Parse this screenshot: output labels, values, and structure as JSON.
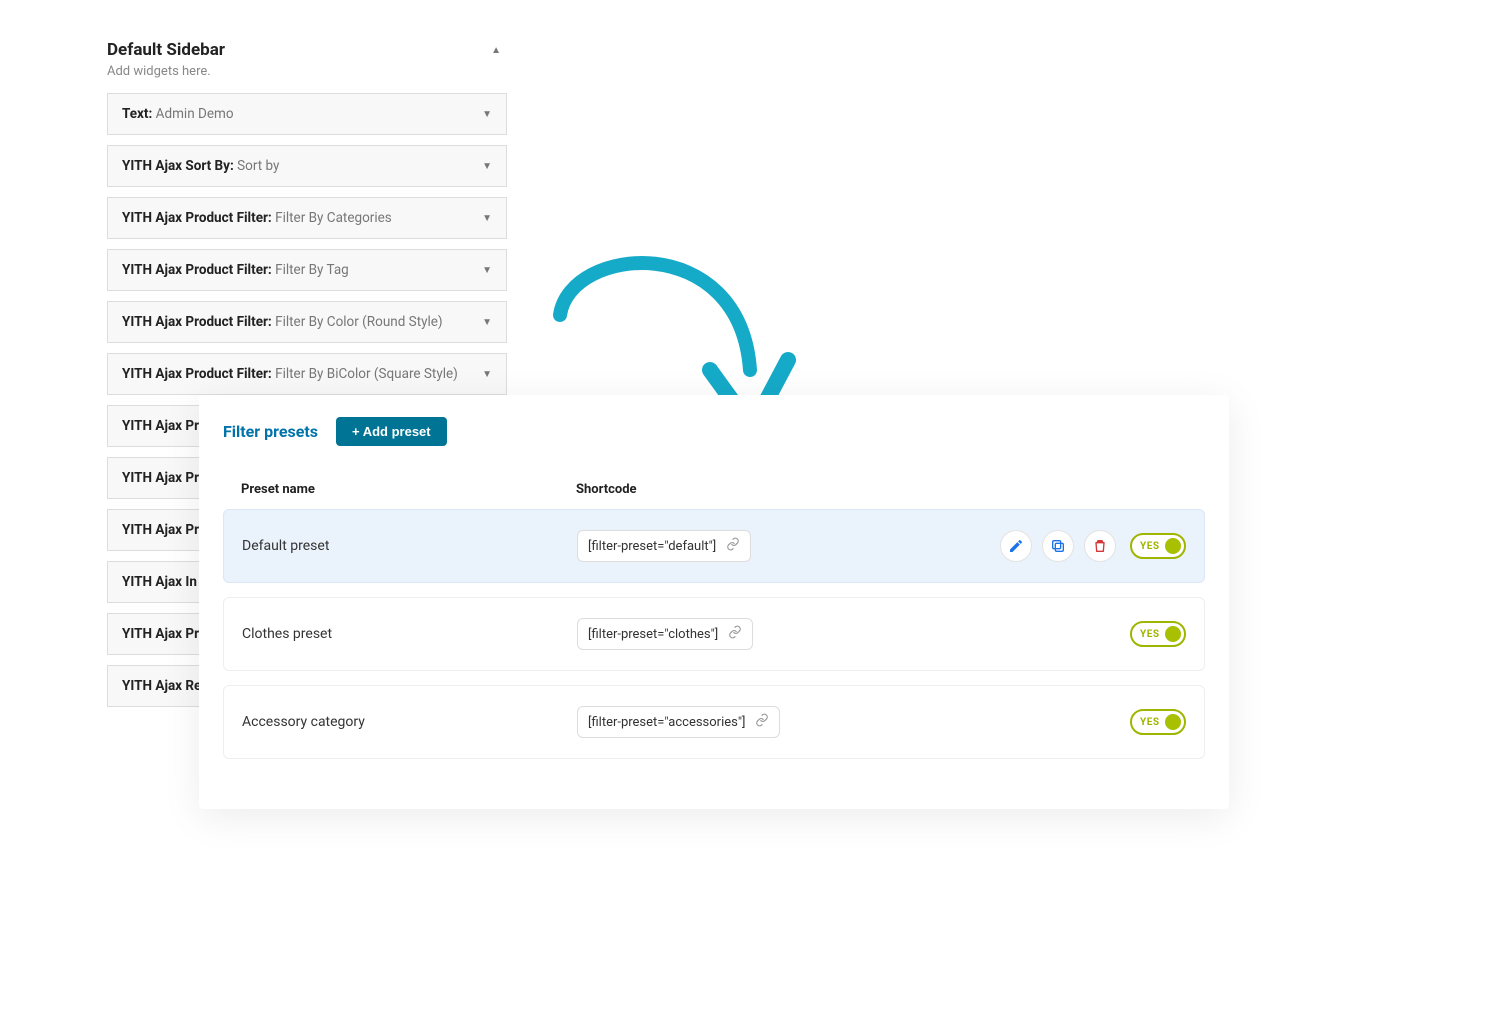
{
  "sidebar": {
    "title": "Default Sidebar",
    "subtitle": "Add widgets here.",
    "widgets": [
      {
        "strong": "Text",
        "sub": "Admin Demo",
        "full": true
      },
      {
        "strong": "YITH Ajax Sort By",
        "sub": "Sort by",
        "full": true
      },
      {
        "strong": "YITH Ajax Product Filter",
        "sub": "Filter By Categories",
        "full": true
      },
      {
        "strong": "YITH Ajax Product Filter",
        "sub": "Filter By Tag",
        "full": true
      },
      {
        "strong": "YITH Ajax Product Filter",
        "sub": "Filter By Color (Round Style)",
        "full": true
      },
      {
        "strong": "YITH Ajax Product Filter",
        "sub": "Filter By BiColor (Square Style)",
        "full": true
      },
      {
        "strong": "YITH Ajax Pr",
        "sub": "",
        "full": false
      },
      {
        "strong": "YITH Ajax Pr",
        "sub": "",
        "full": false
      },
      {
        "strong": "YITH Ajax Pr",
        "sub": "",
        "full": false
      },
      {
        "strong": "YITH Ajax In",
        "sub": "",
        "full": false
      },
      {
        "strong": "YITH Ajax Pr",
        "sub": "",
        "full": false
      },
      {
        "strong": "YITH Ajax Re",
        "sub": "",
        "full": false
      }
    ]
  },
  "panel": {
    "title": "Filter presets",
    "add_label": "+ Add preset",
    "head_name": "Preset name",
    "head_code": "Shortcode",
    "toggle_label": "YES",
    "rows": [
      {
        "name": "Default preset",
        "code": "[filter-preset=\"default\"]",
        "active": true
      },
      {
        "name": "Clothes preset",
        "code": "[filter-preset=\"clothes\"]",
        "active": false
      },
      {
        "name": "Accessory category",
        "code": "[filter-preset=\"accessories\"]",
        "active": false
      }
    ]
  }
}
